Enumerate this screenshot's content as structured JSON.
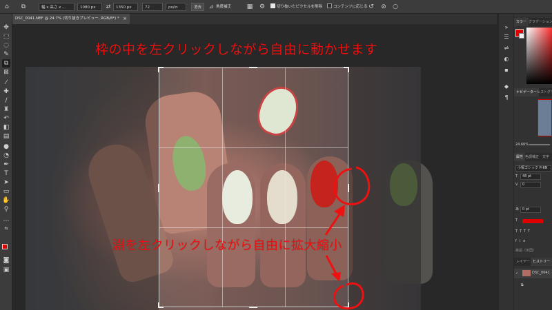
{
  "options_bar": {
    "ratio_select": "幅 x 高さ x ...",
    "width_value": "1080 px",
    "height_value": "1350 px",
    "resolution_value": "72",
    "resolution_unit": "px/in",
    "clear_button": "消去",
    "straighten_label": "角度補正",
    "delete_cropped_label": "切り抜いたピクセルを削除",
    "delete_cropped_checked": true,
    "content_aware_label": "コンテンツに応じる",
    "content_aware_checked": false
  },
  "document": {
    "tab_title": "DSC_0041.NEF @ 24.7% (切り抜きプレビュー, RGB/8*) *",
    "close_glyph": "×"
  },
  "annotations": {
    "top_text": "枠の中を左クリックしながら自由に動かせます",
    "bottom_text": "淵を左クリックしながら自由に拡大縮小",
    "color": "#ee1111"
  },
  "tools": {
    "foreground_color": "#e00000",
    "background_color": "#ffffff"
  },
  "panels": {
    "color_tabs": [
      "カラー",
      "グラデーション"
    ],
    "navigator_tabs": [
      "ナビゲーター",
      "ヒストグラム"
    ],
    "zoom_value": "24.66%",
    "properties_tabs": [
      "属性",
      "色調補正",
      "文字"
    ],
    "font_family": "小塚ゴシック Pr6N",
    "font_size": "48 pt",
    "kerning": "0",
    "tracking": "0 pt",
    "language": "英語（米国）",
    "layers_tabs": [
      "レイヤー",
      "ヒストリー"
    ],
    "history_item": "DSC_0041"
  },
  "icons": [
    "crop-tool-icon",
    "rotate-reset-icon",
    "cancel-icon",
    "gear-icon",
    "grid-icon"
  ]
}
